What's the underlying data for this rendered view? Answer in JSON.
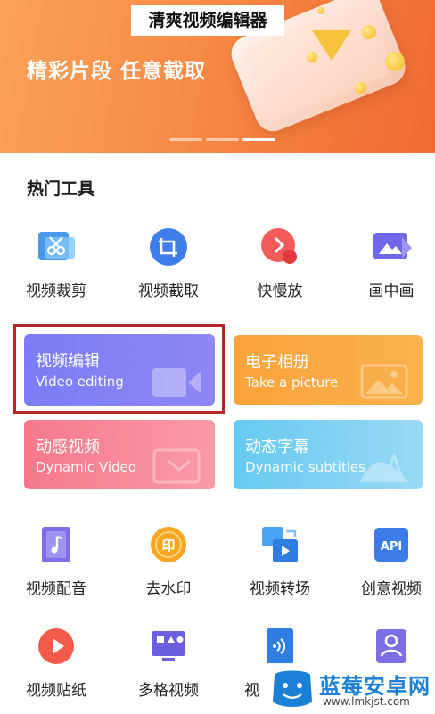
{
  "banner": {
    "app_title": "清爽视频编辑器",
    "slogan": "精彩片段 任意截取",
    "carousel_pages": 3,
    "active_page": 3
  },
  "hot_tools": {
    "title": "热门工具",
    "row1": [
      {
        "label": "视频裁剪",
        "icon": "video-crop-icon"
      },
      {
        "label": "视频截取",
        "icon": "video-trim-icon"
      },
      {
        "label": "快慢放",
        "icon": "speed-icon"
      },
      {
        "label": "画中画",
        "icon": "picture-in-picture-icon"
      }
    ],
    "cards": [
      {
        "title": "视频编辑",
        "subtitle": "Video editing",
        "icon": "video-camera-icon",
        "color": "#7b7df6"
      },
      {
        "title": "电子相册",
        "subtitle": "Take a picture",
        "icon": "image-icon",
        "color": "#f9a23b"
      },
      {
        "title": "动感视频",
        "subtitle": "Dynamic Video",
        "icon": "dynamic-video-icon",
        "color": "#f6788c"
      },
      {
        "title": "动态字幕",
        "subtitle": "Dynamic subtitles",
        "icon": "subtitle-icon",
        "color": "#66c9f0"
      }
    ],
    "row2": [
      {
        "label": "视频配音",
        "icon": "music-note-icon"
      },
      {
        "label": "去水印",
        "icon": "stamp-icon"
      },
      {
        "label": "视频转场",
        "icon": "transition-icon"
      },
      {
        "label": "创意视频",
        "icon": "api-icon"
      }
    ],
    "row3": [
      {
        "label": "视频贴纸",
        "icon": "play-sticker-icon"
      },
      {
        "label": "多格视频",
        "icon": "grid-video-icon"
      },
      {
        "label": "视",
        "icon": "nfc-icon"
      },
      {
        "label": "",
        "icon": "person-icon"
      }
    ]
  },
  "watermark": {
    "name": "蓝莓安卓网",
    "url": "www.lmkjst.com"
  }
}
